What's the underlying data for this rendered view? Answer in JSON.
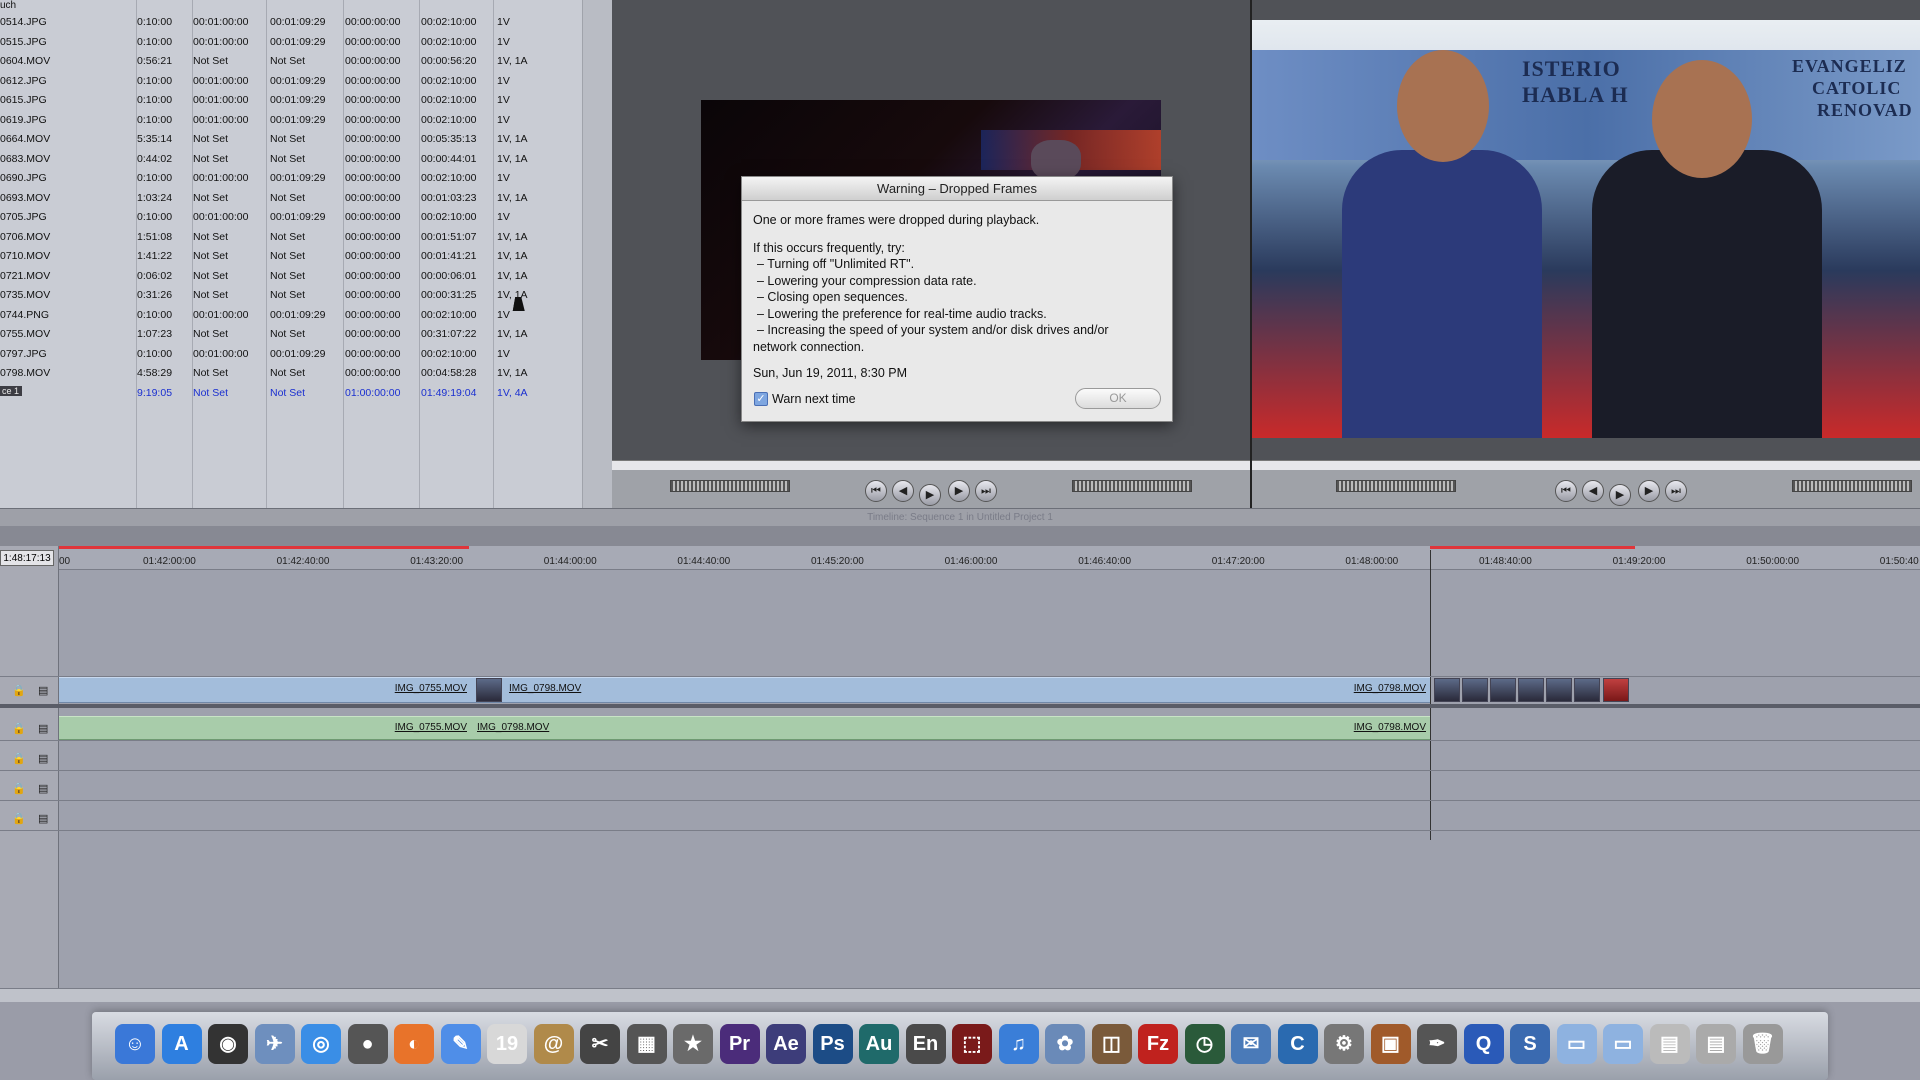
{
  "browser": {
    "header": "uch",
    "rows": [
      [
        "0514.JPG",
        "0:10:00",
        "00:01:00:00",
        "00:01:09:29",
        "00:00:00:00",
        "00:02:10:00",
        "1V"
      ],
      [
        "0515.JPG",
        "0:10:00",
        "00:01:00:00",
        "00:01:09:29",
        "00:00:00:00",
        "00:02:10:00",
        "1V"
      ],
      [
        "0604.MOV",
        "0:56:21",
        "Not Set",
        "Not Set",
        "00:00:00:00",
        "00:00:56:20",
        "1V, 1A"
      ],
      [
        "0612.JPG",
        "0:10:00",
        "00:01:00:00",
        "00:01:09:29",
        "00:00:00:00",
        "00:02:10:00",
        "1V"
      ],
      [
        "0615.JPG",
        "0:10:00",
        "00:01:00:00",
        "00:01:09:29",
        "00:00:00:00",
        "00:02:10:00",
        "1V"
      ],
      [
        "0619.JPG",
        "0:10:00",
        "00:01:00:00",
        "00:01:09:29",
        "00:00:00:00",
        "00:02:10:00",
        "1V"
      ],
      [
        "0664.MOV",
        "5:35:14",
        "Not Set",
        "Not Set",
        "00:00:00:00",
        "00:05:35:13",
        "1V, 1A"
      ],
      [
        "0683.MOV",
        "0:44:02",
        "Not Set",
        "Not Set",
        "00:00:00:00",
        "00:00:44:01",
        "1V, 1A"
      ],
      [
        "0690.JPG",
        "0:10:00",
        "00:01:00:00",
        "00:01:09:29",
        "00:00:00:00",
        "00:02:10:00",
        "1V"
      ],
      [
        "0693.MOV",
        "1:03:24",
        "Not Set",
        "Not Set",
        "00:00:00:00",
        "00:01:03:23",
        "1V, 1A"
      ],
      [
        "0705.JPG",
        "0:10:00",
        "00:01:00:00",
        "00:01:09:29",
        "00:00:00:00",
        "00:02:10:00",
        "1V"
      ],
      [
        "0706.MOV",
        "1:51:08",
        "Not Set",
        "Not Set",
        "00:00:00:00",
        "00:01:51:07",
        "1V, 1A"
      ],
      [
        "0710.MOV",
        "1:41:22",
        "Not Set",
        "Not Set",
        "00:00:00:00",
        "00:01:41:21",
        "1V, 1A"
      ],
      [
        "0721.MOV",
        "0:06:02",
        "Not Set",
        "Not Set",
        "00:00:00:00",
        "00:00:06:01",
        "1V, 1A"
      ],
      [
        "0735.MOV",
        "0:31:26",
        "Not Set",
        "Not Set",
        "00:00:00:00",
        "00:00:31:25",
        "1V, 1A"
      ],
      [
        "0744.PNG",
        "0:10:00",
        "00:01:00:00",
        "00:01:09:29",
        "00:00:00:00",
        "00:02:10:00",
        "1V"
      ],
      [
        "0755.MOV",
        "1:07:23",
        "Not Set",
        "Not Set",
        "00:00:00:00",
        "00:31:07:22",
        "1V, 1A"
      ],
      [
        "0797.JPG",
        "0:10:00",
        "00:01:00:00",
        "00:01:09:29",
        "00:00:00:00",
        "00:02:10:00",
        "1V"
      ],
      [
        "0798.MOV",
        "4:58:29",
        "Not Set",
        "Not Set",
        "00:00:00:00",
        "00:04:58:28",
        "1V, 1A"
      ]
    ],
    "selected_row": [
      "ce 1",
      "9:19:05",
      "Not Set",
      "Not Set",
      "01:00:00:00",
      "01:49:19:04",
      "1V, 4A"
    ]
  },
  "dialog": {
    "title": "Warning – Dropped Frames",
    "line1": "One or more frames were dropped during playback.",
    "line2": "If this occurs frequently, try:",
    "tips": [
      "– Turning off \"Unlimited RT\".",
      "– Lowering your compression data rate.",
      "– Closing open sequences.",
      "– Lowering the preference for real-time audio tracks.",
      "– Increasing the speed of your system and/or disk drives and/or",
      "network connection."
    ],
    "timestamp": "Sun, Jun 19, 2011, 8:30 PM",
    "checkbox_label": "Warn next time",
    "ok_label": "OK"
  },
  "canvas": {
    "banner_left": "ISTERIO",
    "banner_left2": "HABLA H",
    "banner_right": "EVANGELIZ",
    "banner_right2": "CATOLIC",
    "banner_right3": "RENOVAD"
  },
  "timeline": {
    "title": "Timeline: Sequence 1 in Untitled Project 1",
    "timecode": "1:48:17:13",
    "ruler_labels": [
      "00",
      "01:42:00:00",
      "01:42:40:00",
      "01:43:20:00",
      "01:44:00:00",
      "01:44:40:00",
      "01:45:20:00",
      "01:46:00:00",
      "01:46:40:00",
      "01:47:20:00",
      "01:48:00:00",
      "01:48:40:00",
      "01:49:20:00",
      "01:50:00:00",
      "01:50:40"
    ],
    "video_clips": [
      "IMG_0755.MOV",
      "IMG_0798.MOV",
      "IMG_0798.MOV"
    ],
    "audio_clips": [
      "IMG_0755.MOV",
      "IMG_0798.MOV",
      "IMG_0798.MOV"
    ]
  },
  "dock": {
    "icons": [
      {
        "name": "finder-icon",
        "glyph": "☺",
        "color": "#3a78d8"
      },
      {
        "name": "app-store-icon",
        "glyph": "A",
        "color": "#2e7fe0"
      },
      {
        "name": "dashboard-icon",
        "glyph": "◉",
        "color": "#333"
      },
      {
        "name": "preview-icon",
        "glyph": "✈",
        "color": "#6e8fbe"
      },
      {
        "name": "safari-icon",
        "glyph": "◎",
        "color": "#3a8ee6"
      },
      {
        "name": "webcam-icon",
        "glyph": "●",
        "color": "#555"
      },
      {
        "name": "firefox-icon",
        "glyph": "◐",
        "color": "#e8732a"
      },
      {
        "name": "ichat-icon",
        "glyph": "✎",
        "color": "#4f8ee8"
      },
      {
        "name": "calendar-icon",
        "glyph": "19",
        "color": "#d8d8d8"
      },
      {
        "name": "address-book-icon",
        "glyph": "@",
        "color": "#b08a4a"
      },
      {
        "name": "final-cut-icon",
        "glyph": "✂",
        "color": "#444"
      },
      {
        "name": "clapper-icon",
        "glyph": "▦",
        "color": "#555"
      },
      {
        "name": "imovie-icon",
        "glyph": "★",
        "color": "#6a6a6a"
      },
      {
        "name": "premiere-icon",
        "glyph": "Pr",
        "color": "#4b2c7a"
      },
      {
        "name": "after-effects-icon",
        "glyph": "Ae",
        "color": "#3d3d7a"
      },
      {
        "name": "photoshop-icon",
        "glyph": "Ps",
        "color": "#1c4c86"
      },
      {
        "name": "audition-icon",
        "glyph": "Au",
        "color": "#1f6a6a"
      },
      {
        "name": "encore-icon",
        "glyph": "En",
        "color": "#4a4a4a"
      },
      {
        "name": "acrobat-icon",
        "glyph": "⬚",
        "color": "#7a1a1a"
      },
      {
        "name": "itunes-icon",
        "glyph": "♫",
        "color": "#3a7ed8"
      },
      {
        "name": "iphoto-icon",
        "glyph": "✿",
        "color": "#6a8ab8"
      },
      {
        "name": "image-capture-icon",
        "glyph": "◫",
        "color": "#7a5a3a"
      },
      {
        "name": "filezilla-icon",
        "glyph": "Fz",
        "color": "#c0221e"
      },
      {
        "name": "time-machine-icon",
        "glyph": "◷",
        "color": "#2a5a3a"
      },
      {
        "name": "script-editor-icon",
        "glyph": "✉",
        "color": "#4a7ab8"
      },
      {
        "name": "c-app-icon",
        "glyph": "C",
        "color": "#2a6ab0"
      },
      {
        "name": "system-preferences-icon",
        "glyph": "⚙",
        "color": "#777"
      },
      {
        "name": "keynote-icon",
        "glyph": "▣",
        "color": "#a05a2a"
      },
      {
        "name": "utility-icon",
        "glyph": "✒",
        "color": "#555"
      },
      {
        "name": "quicktime-icon",
        "glyph": "Q",
        "color": "#2a5ab8"
      },
      {
        "name": "cp-app-icon",
        "glyph": "S",
        "color": "#3a6ab0"
      },
      {
        "name": "applications-folder-icon",
        "glyph": "▭",
        "color": "#8eb2e0"
      },
      {
        "name": "documents-folder-icon",
        "glyph": "▭",
        "color": "#8eb2e0"
      },
      {
        "name": "downloads-stack-icon",
        "glyph": "▤",
        "color": "#bbb"
      },
      {
        "name": "desktop-stack-icon",
        "glyph": "▤",
        "color": "#aaa"
      },
      {
        "name": "trash-icon",
        "glyph": "🗑",
        "color": "#999"
      }
    ]
  }
}
